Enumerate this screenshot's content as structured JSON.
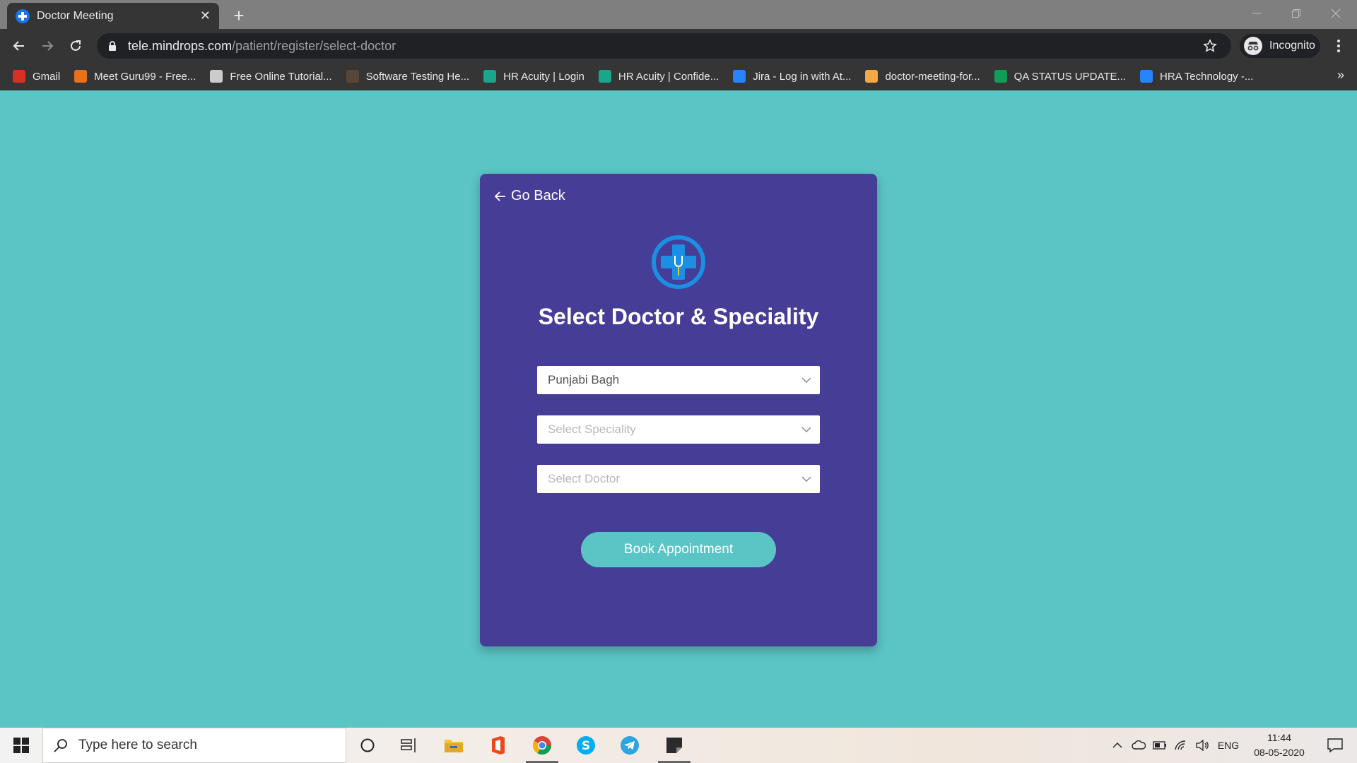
{
  "browser": {
    "tab_title": "Doctor Meeting",
    "url_host": "tele.mindrops.com",
    "url_path": "/patient/register/select-doctor",
    "profile_label": "Incognito",
    "bookmarks": [
      {
        "label": "Gmail",
        "icon": "gmail-icon",
        "color": "#d93025"
      },
      {
        "label": "Meet Guru99 - Free...",
        "icon": "guru99-icon",
        "color": "#e8711a"
      },
      {
        "label": "Free Online Tutorial...",
        "icon": "tutorial-icon",
        "color": "#cccccc"
      },
      {
        "label": "Software Testing He...",
        "icon": "testing-icon",
        "color": "#5a4636"
      },
      {
        "label": "HR Acuity | Login",
        "icon": "hr-acuity-icon",
        "color": "#1aa68a"
      },
      {
        "label": "HR Acuity | Confide...",
        "icon": "hr-acuity-icon",
        "color": "#1aa68a"
      },
      {
        "label": "Jira - Log in with At...",
        "icon": "atlassian-icon",
        "color": "#2684ff"
      },
      {
        "label": "doctor-meeting-for...",
        "icon": "form-icon",
        "color": "#f4a742"
      },
      {
        "label": "QA STATUS UPDATE...",
        "icon": "sheets-icon",
        "color": "#0f9d58"
      },
      {
        "label": "HRA Technology -...",
        "icon": "atlassian-icon",
        "color": "#2684ff"
      }
    ],
    "bookmarks_overflow": "»"
  },
  "page": {
    "go_back_label": "Go Back",
    "heading": "Select Doctor & Speciality",
    "location_select": {
      "value": "Punjabi Bagh"
    },
    "speciality_select": {
      "placeholder": "Select Speciality"
    },
    "doctor_select": {
      "placeholder": "Select Doctor"
    },
    "book_button_label": "Book Appointment"
  },
  "taskbar": {
    "search_placeholder": "Type here to search",
    "language": "ENG",
    "time": "11:44",
    "date": "08-05-2020"
  },
  "colors": {
    "page_background": "#5bc4c4",
    "card_background": "#463e96",
    "accent": "#5bc4c4",
    "logo_blue": "#1a8fe3"
  }
}
